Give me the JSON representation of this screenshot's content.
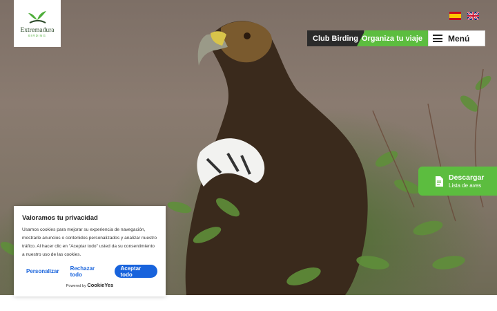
{
  "logo": {
    "brand": "Extremadura",
    "sub": "BIRDING"
  },
  "languages": [
    {
      "code": "es",
      "icon": "spain-flag-icon"
    },
    {
      "code": "en",
      "icon": "uk-flag-icon"
    }
  ],
  "nav": {
    "club": "Club Birding",
    "trip": "Organiza tu viaje",
    "menu": "Menú"
  },
  "download": {
    "title": "Descargar",
    "subtitle": "Lista de aves",
    "icon": "document-icon"
  },
  "cookie": {
    "title": "Valoramos tu privacidad",
    "body": "Usamos cookies para mejorar su experiencia de navegación, mostrarle anuncios o contenidos personalizados y analizar nuestro tráfico. Al hacer clic en \"Aceptar todo\" usted da su consentimiento a nuestro uso de las cookies.",
    "customize": "Personalizar",
    "reject": "Rechazar todo",
    "accept": "Aceptar todo",
    "powered_by": "Powered by",
    "powered_brand": "CookieYes"
  },
  "colors": {
    "accent_green": "#5cbd3f",
    "dark": "#2b2b2b",
    "cookie_blue": "#1863dc"
  }
}
